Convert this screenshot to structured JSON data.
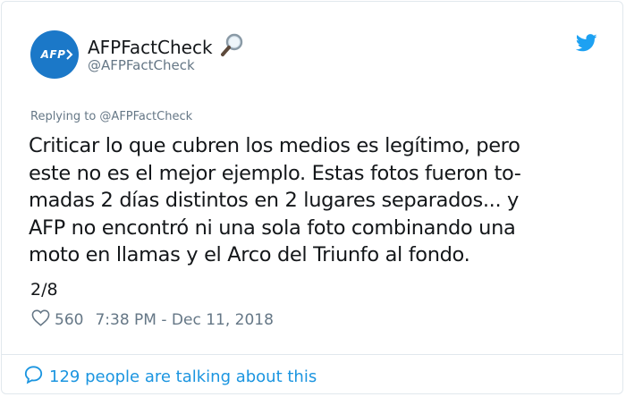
{
  "author": {
    "display_name": "AFPFactCheck",
    "handle": "@AFPFactCheck",
    "avatar_text": "AFP",
    "verified_icon": "magnifier-icon"
  },
  "brand_icon": "twitter-bird-icon",
  "replying_to": "Replying to @AFPFactCheck",
  "tweet": {
    "text": "Criticar lo que cubren los medios es legítimo, pero\neste no es el mejor ejemplo. Estas fotos fueron to-\nmadas 2 días distintos en 2 lugares separados... y\nAFP no encontró ni una sola foto combinando una\nmoto en llamas y el Arco del Triunfo al fondo.",
    "thread_position": "2/8"
  },
  "meta": {
    "like_count": "560",
    "timestamp": "7:38 PM - Dec 11, 2018"
  },
  "footer": {
    "talking_label": "129 people are talking about this"
  },
  "colors": {
    "avatar_bg": "#1b78c8",
    "brand_blue": "#1da1f2",
    "link_blue": "#1b95e0",
    "muted": "#657786",
    "text": "#14171a",
    "border": "#e1e8ed"
  }
}
